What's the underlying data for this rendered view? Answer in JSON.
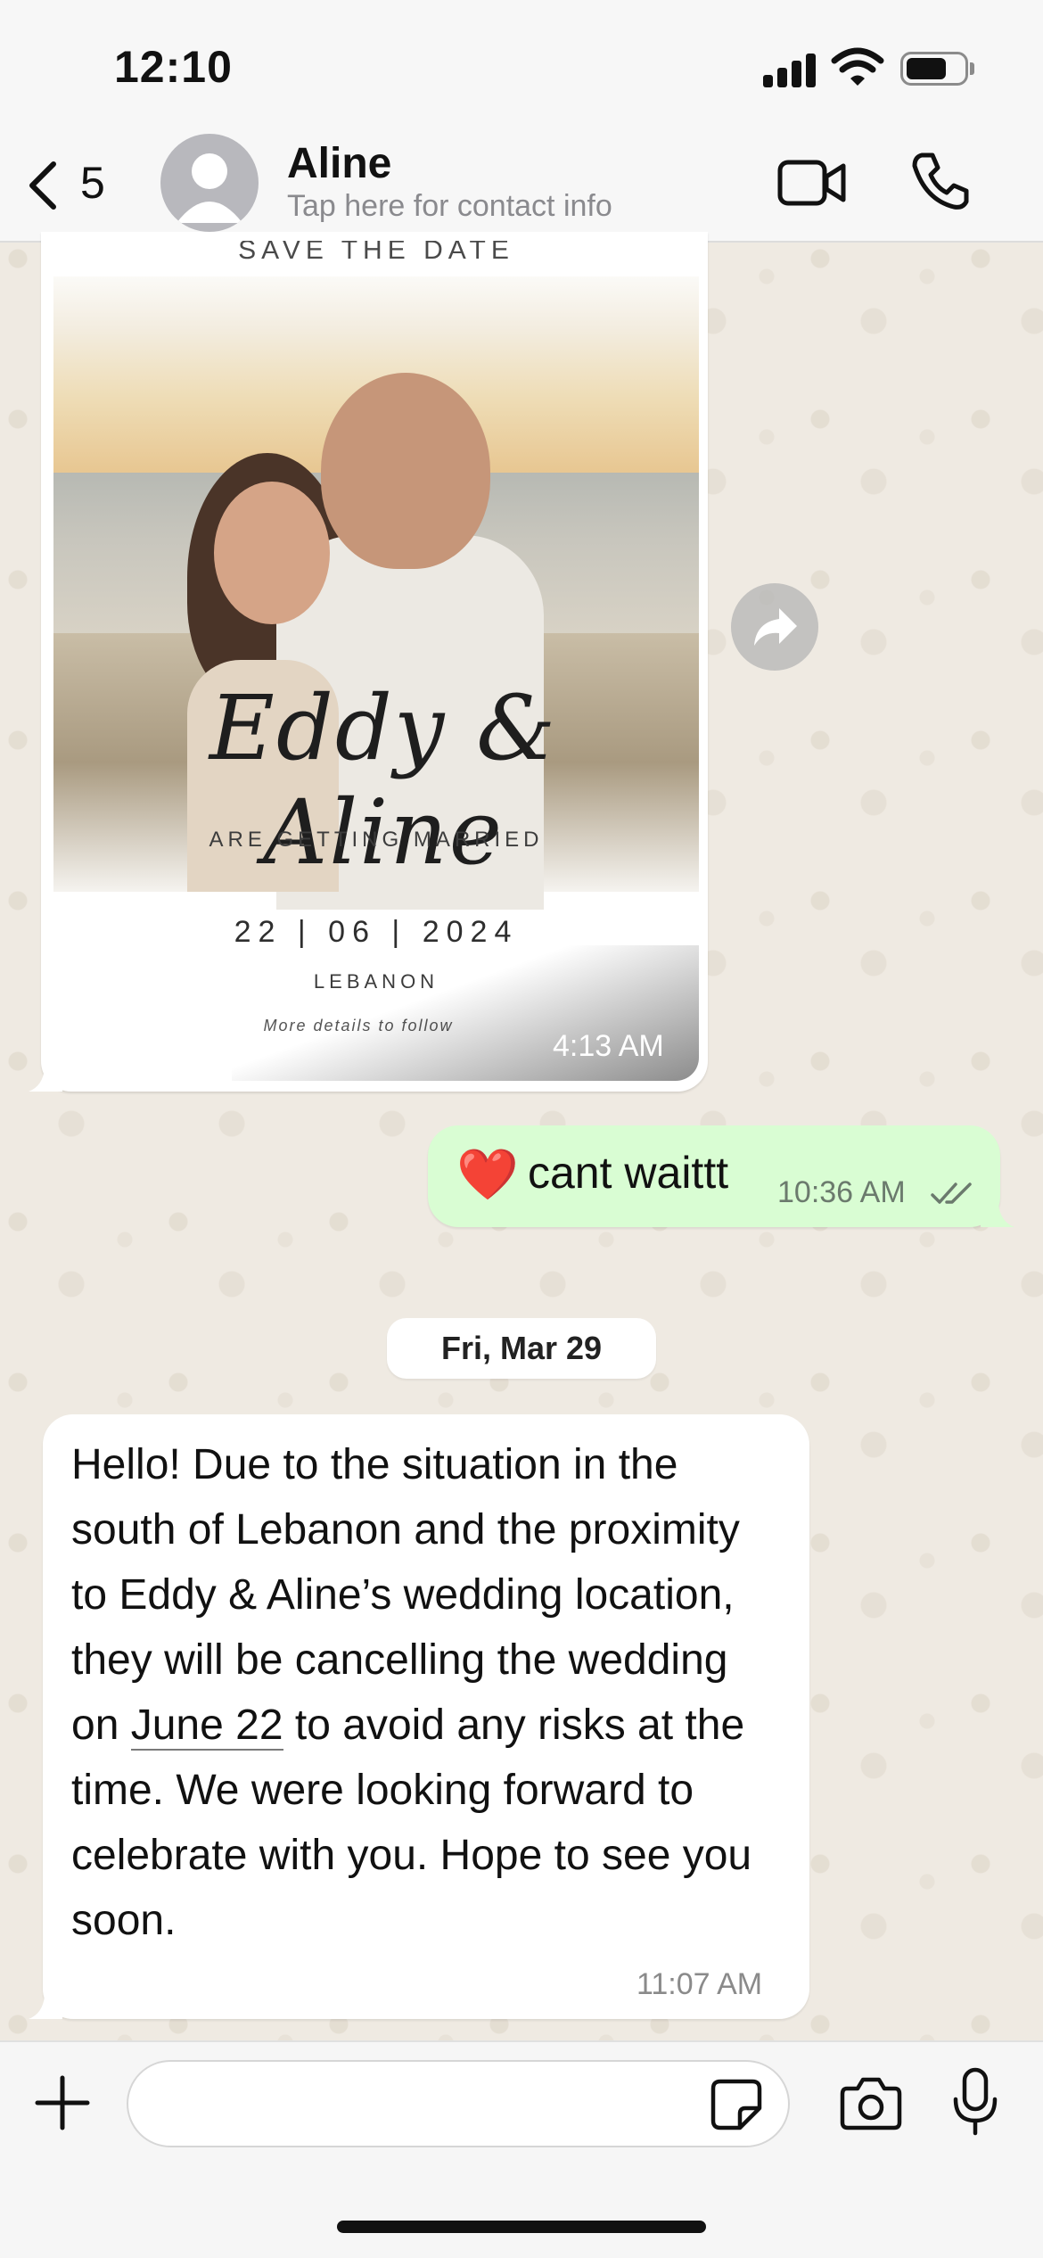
{
  "status_bar": {
    "time": "12:10",
    "icons": [
      "cellular-signal-icon",
      "wifi-icon",
      "battery-icon"
    ]
  },
  "header": {
    "back_count": "5",
    "contact_name": "Aline",
    "contact_subtitle": "Tap here for contact info",
    "icons": [
      "back-chevron-icon",
      "avatar-placeholder-icon",
      "video-call-icon",
      "voice-call-icon"
    ]
  },
  "messages": {
    "image_message": {
      "invitation": {
        "save_the_date": "SAVE THE DATE",
        "names": "Eddy & Aline",
        "getting_married": "ARE GETTING MARRIED",
        "date": "22 | 06 | 2024",
        "location": "LEBANON",
        "more_details": "More details to follow"
      },
      "time": "4:13 AM"
    },
    "outgoing": {
      "emoji": "❤️",
      "text": "cant waittt",
      "time": "10:36 AM",
      "status": "read"
    },
    "date_separator": "Fri, Mar 29",
    "incoming": {
      "text_before_link": "Hello! Due to the situation in the south of Lebanon and the proximity to Eddy & Aline’s wedding location, they will be cancelling the wedding on ",
      "link_text": "June 22",
      "text_after_link": " to avoid any risks at the time. We were looking forward to celebrate with you. Hope to see you soon.",
      "time": "11:07 AM"
    }
  },
  "input_bar": {
    "value": "",
    "placeholder": "",
    "icons": [
      "plus-icon",
      "sticker-icon",
      "camera-icon",
      "microphone-icon"
    ]
  },
  "colors": {
    "outgoing_bubble": "#d9fdd3",
    "incoming_bubble": "#ffffff",
    "wallpaper": "#efeae2",
    "read_ticks": "#6b7a6d"
  }
}
